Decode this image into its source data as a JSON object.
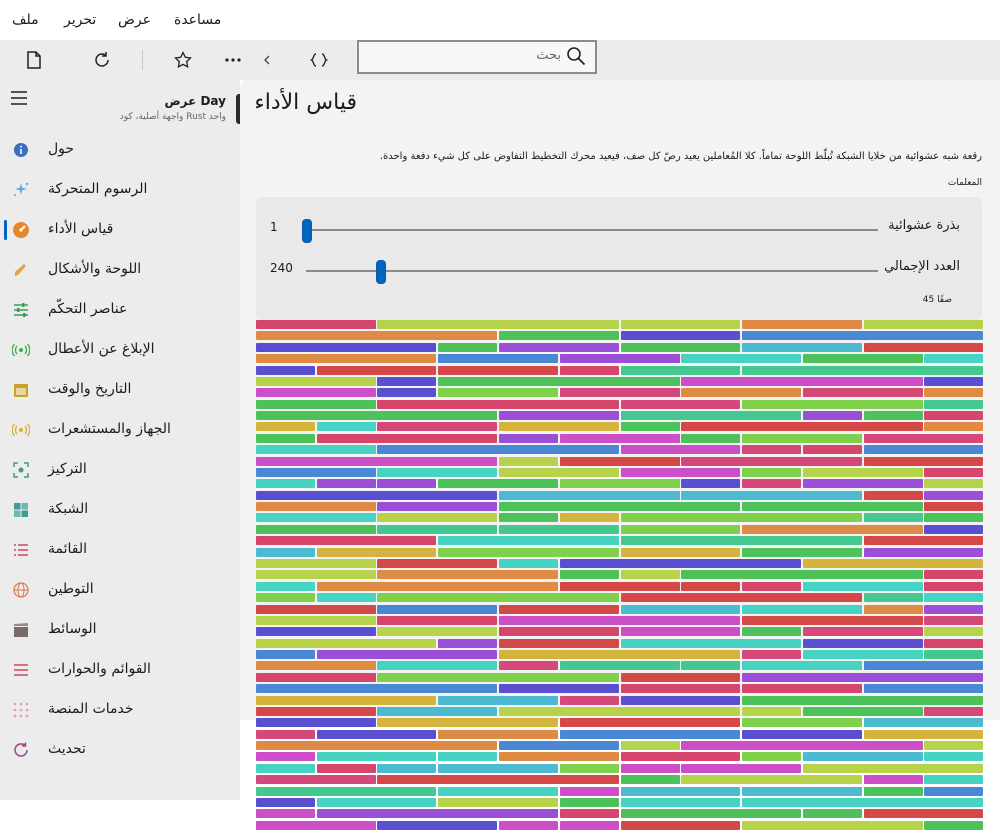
{
  "menu": [
    "ملف",
    "تحرير",
    "عرض",
    "مساعدة"
  ],
  "search": {
    "placeholder": "بحث"
  },
  "app": {
    "title": "عرض Day",
    "subtitle": "واجهة أصلية، كود Rust واحد"
  },
  "sidebar": {
    "items": [
      {
        "label": "حول",
        "icon": "info-icon",
        "color": "#3a6fc4"
      },
      {
        "label": "الرسوم المتحركة",
        "icon": "sparkle-icon",
        "color": "#5aa8e6"
      },
      {
        "label": "قياس الأداء",
        "icon": "gauge-icon",
        "color": "#e8862a",
        "selected": true
      },
      {
        "label": "اللوحة والأشكال",
        "icon": "brush-icon",
        "color": "#e8a23a"
      },
      {
        "label": "عناصر التحكّم",
        "icon": "sliders-icon",
        "color": "#3a9e5a"
      },
      {
        "label": "الإبلاغ عن الأعطال",
        "icon": "broadcast-icon",
        "color": "#3aaa4a"
      },
      {
        "label": "التاريخ والوقت",
        "icon": "calendar-icon",
        "color": "#c9a02a"
      },
      {
        "label": "الجهاز والمستشعرات",
        "icon": "signal-icon",
        "color": "#d4b030"
      },
      {
        "label": "التركيز",
        "icon": "focus-icon",
        "color": "#3a9e8a"
      },
      {
        "label": "الشبكة",
        "icon": "grid-icon",
        "color": "#3a9e9a"
      },
      {
        "label": "القائمة",
        "icon": "list-icon",
        "color": "#d4445a"
      },
      {
        "label": "التوطين",
        "icon": "globe-icon",
        "color": "#e07a5a"
      },
      {
        "label": "الوسائط",
        "icon": "clapper-icon",
        "color": "#7a6a6a"
      },
      {
        "label": "القوائم والحوارات",
        "icon": "menu-lines-icon",
        "color": "#d4445a"
      },
      {
        "label": "خدمات المنصة",
        "icon": "dots-grid-icon",
        "color": "#e0a0b0"
      },
      {
        "label": "تحديث",
        "icon": "refresh-icon",
        "color": "#a04a8a"
      }
    ]
  },
  "page": {
    "title": "قياس الأداء",
    "description": "رقعة شبه عشوائية من خلايا الشبكة تُبلّط اللوحة تماماً. كلا المُعاملين يعيد رصّ كل صف، فيعيد محرك التخطيط التفاوض على كل شيء دفعة واحدة.",
    "params_label": "المعلمات",
    "seed": {
      "label": "بذرة عشوائية",
      "value": "1",
      "fraction": 0.0
    },
    "count": {
      "label": "العدد الإجمالي",
      "value": "240",
      "fraction": 0.13
    },
    "rows_count": "45 صفًا"
  },
  "palette": [
    "#d6456b",
    "#4dc15a",
    "#9b4ed6",
    "#d4b43c",
    "#4cbad1",
    "#d4487a",
    "#4a88d6",
    "#cc4fc8",
    "#46d3c2",
    "#e08b45",
    "#b7d34b",
    "#5a4fd0",
    "#d44848",
    "#45c890",
    "#7fd04a"
  ]
}
